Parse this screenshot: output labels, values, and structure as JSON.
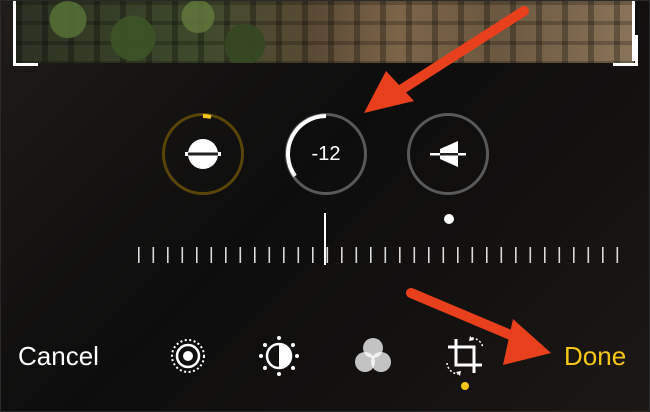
{
  "crop_dials": {
    "straighten": {
      "icon": "straighten-icon"
    },
    "vertical": {
      "value": "-12",
      "icon": "vertical-perspective-icon"
    },
    "horizontal": {
      "icon": "horizontal-perspective-icon"
    }
  },
  "adjust_slider": {
    "value": -12
  },
  "toolbar": {
    "cancel_label": "Cancel",
    "done_label": "Done",
    "tools": [
      "live-photo-icon",
      "adjust-icon",
      "filters-icon",
      "crop-icon"
    ],
    "active_tool": "crop-icon"
  },
  "colors": {
    "accent": "#f5c518",
    "arrow": "#e8401c",
    "dial_inactive": "#595959",
    "dial_active_ring": "#5a4506"
  }
}
